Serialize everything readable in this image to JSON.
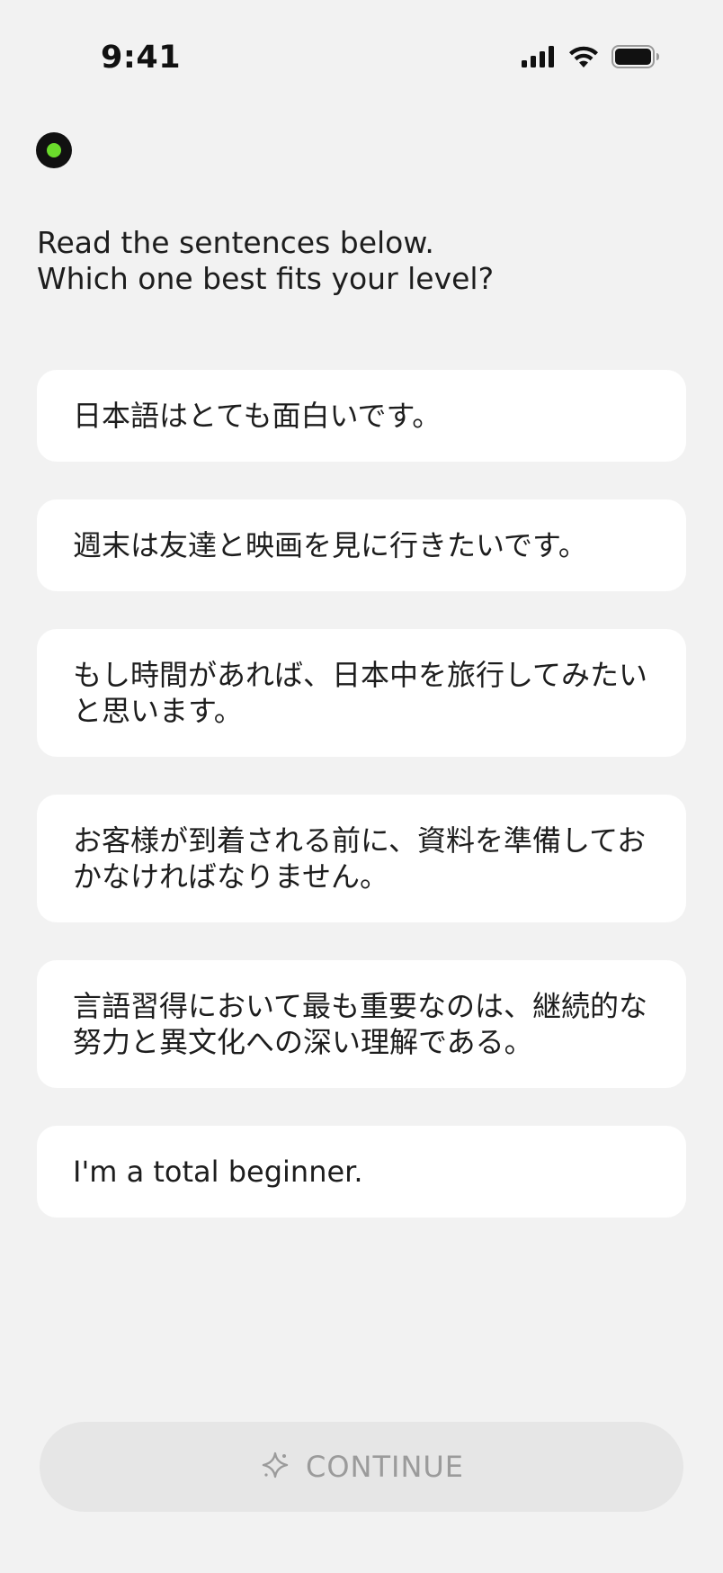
{
  "status_bar": {
    "time": "9:41",
    "icons": [
      "cellular-signal-icon",
      "wifi-icon",
      "battery-icon"
    ]
  },
  "brand": {
    "icon": "brand-dot-icon",
    "dot_color": "#6bdc2c"
  },
  "question": {
    "line1": "Read the sentences below.",
    "line2": "Which one best fits your level?"
  },
  "options": [
    {
      "label": "日本語はとても面白いです。"
    },
    {
      "label": "週末は友達と映画を見に行きたいです。"
    },
    {
      "label": "もし時間があれば、日本中を旅行してみたいと思います。"
    },
    {
      "label": "お客様が到着される前に、資料を準備しておかなければなりません。"
    },
    {
      "label": "言語習得において最も重要なのは、継続的な努力と異文化への深い理解である。"
    },
    {
      "label": "I'm a total beginner."
    }
  ],
  "continue_button": {
    "label": "CONTINUE",
    "icon": "sparkle-icon",
    "state": "disabled"
  }
}
